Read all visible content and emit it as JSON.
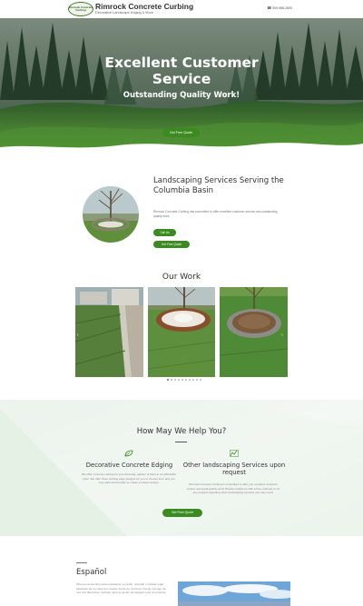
{
  "header": {
    "brand_name": "Rimrock Concrete Curbing",
    "tagline": "Decorative Landscape Edging & More",
    "logo_text": "Rimrock Concrete Curbing",
    "phone": "509-988-2800"
  },
  "hero": {
    "title": "Excellent Customer Service",
    "subtitle": "Outstanding Quality Work!",
    "button": "Get Free Quote"
  },
  "landscaping": {
    "title": "Landscaping Services Serving the Columbia Basin",
    "text": "Rimrock Concrete Curbing has committed to offer excellent customer service and outstanding quality work.",
    "call_button": "Call Us",
    "quote_button": "Get Free Quote"
  },
  "work": {
    "title": "Our Work",
    "prev_arrow": "‹",
    "next_arrow": "›"
  },
  "help": {
    "title": "How May We Help You?",
    "service1": {
      "title": "Decorative Concrete Edging",
      "text": "We offer concrete curbing for your driveway, garden or lawn at an affordable price. We offer three curbing edge designs for you to choose from and you may add colored stain to create a unique design."
    },
    "service2": {
      "title": "Other landscaping Services upon request",
      "text": "Rimrock Concrete Curbing is committed to offer you excellent customer service and great quality work! Please contact us with a free estimate or for any request regarding other landscaping services you may need."
    },
    "button": "Get Free Quote"
  },
  "espanol": {
    "title": "Español",
    "text": "Ofrecemos servicio para embellecer su jardín, creando o instalar lugar alrededor de su casa con nuestro bordo de concreto. Puede escoger de tres dos diferentes, también tiene la opción de agregar color al cemento."
  },
  "colors": {
    "accent": "#3b8b21"
  }
}
